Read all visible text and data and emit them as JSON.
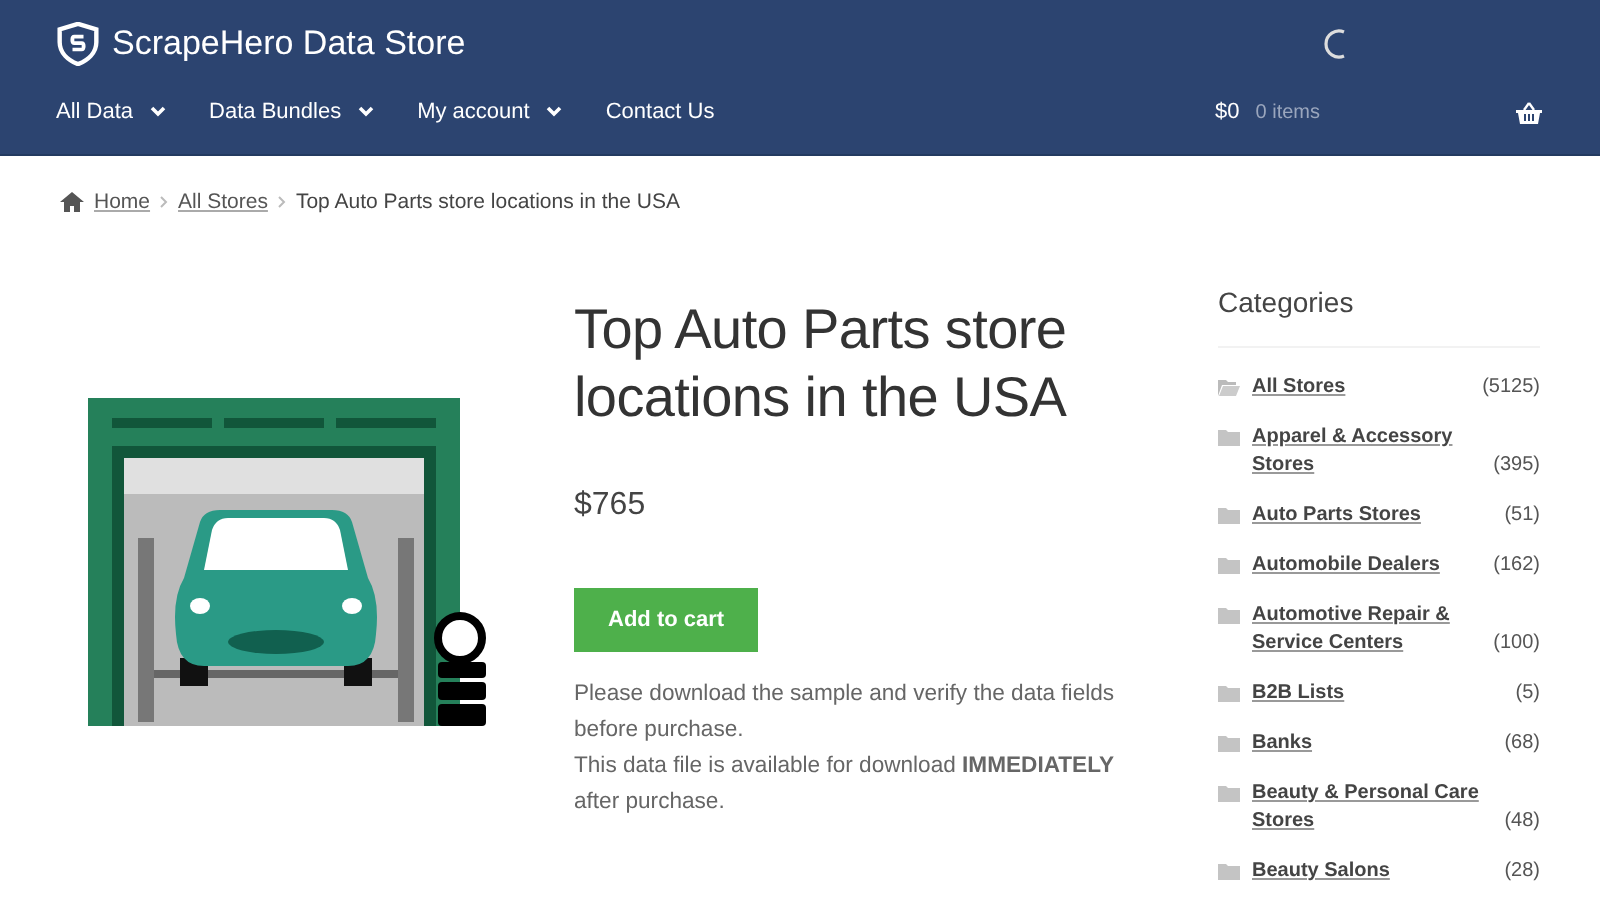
{
  "header": {
    "brand": "ScrapeHero Data Store",
    "nav": [
      {
        "label": "All Data",
        "dropdown": true
      },
      {
        "label": "Data Bundles",
        "dropdown": true
      },
      {
        "label": "My account",
        "dropdown": true
      },
      {
        "label": "Contact Us",
        "dropdown": false
      }
    ],
    "cart_total": "$0",
    "cart_items": "0 items"
  },
  "breadcrumb": {
    "links": [
      "Home",
      "All Stores"
    ],
    "current": "Top Auto Parts store locations in the USA"
  },
  "product": {
    "title": "Top Auto Parts store locations in the USA",
    "price": "$765",
    "button": "Add to cart",
    "description": [
      "Please download the sample and verify the data fields before purchase.",
      "This data file is available for download **IMMEDIATELY** after purchase."
    ]
  },
  "sidebar": {
    "title": "Categories",
    "items": [
      {
        "name": "All Stores",
        "count": "(5125)",
        "open": true
      },
      {
        "name": "Apparel & Accessory Stores",
        "count": "(395)",
        "open": false
      },
      {
        "name": "Auto Parts Stores",
        "count": "(51)",
        "open": false
      },
      {
        "name": "Automobile Dealers",
        "count": "(162)",
        "open": false
      },
      {
        "name": "Automotive Repair & Service Centers",
        "count": "(100)",
        "open": false
      },
      {
        "name": "B2B Lists",
        "count": "(5)",
        "open": false
      },
      {
        "name": "Banks",
        "count": "(68)",
        "open": false
      },
      {
        "name": "Beauty & Personal Care Stores",
        "count": "(48)",
        "open": false
      },
      {
        "name": "Beauty Salons",
        "count": "(28)",
        "open": false
      }
    ]
  }
}
